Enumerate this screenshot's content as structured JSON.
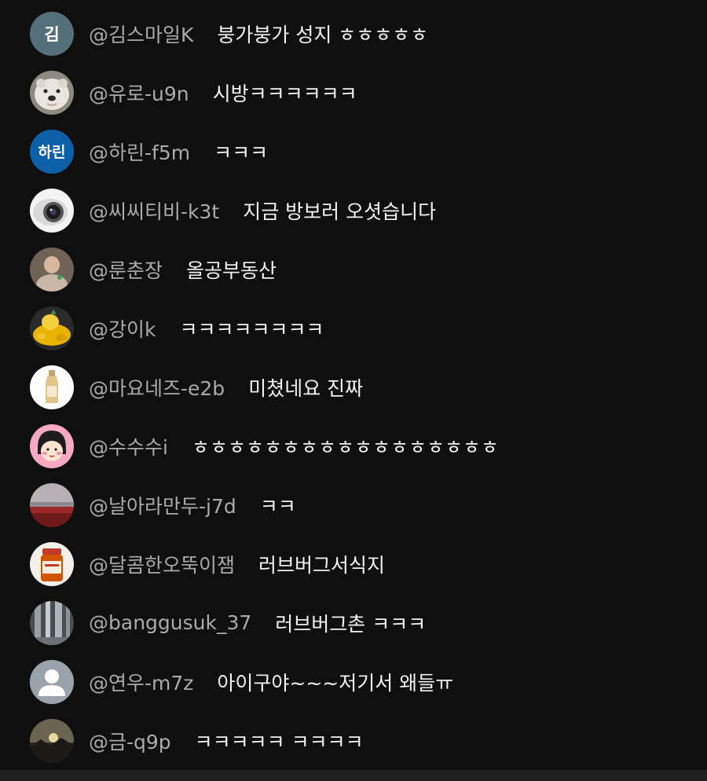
{
  "colors": {
    "background": "#0f0f0f",
    "author_text": "#aaaaaa",
    "message_text": "#f1f1f1",
    "bottom_bar": "#1f1f1f"
  },
  "messages": [
    {
      "author": "@김스마일K",
      "text": "붕가붕가 성지 ㅎㅎㅎㅎㅎ",
      "avatar": {
        "type": "initial",
        "letter": "김",
        "color": "#546e7a"
      }
    },
    {
      "author": "@유로-u9n",
      "text": "시방ㅋㅋㅋㅋㅋㅋ",
      "avatar": {
        "type": "image",
        "icon": "polar-bear-photo"
      }
    },
    {
      "author": "@하린-f5m",
      "text": "ㅋㅋㅋ",
      "avatar": {
        "type": "initial",
        "letter": "하린",
        "color": "#0d5fa8"
      }
    },
    {
      "author": "@씨씨티비-k3t",
      "text": "지금 방보러 오셧습니다",
      "avatar": {
        "type": "image",
        "icon": "cctv-camera-photo"
      }
    },
    {
      "author": "@룬춘장",
      "text": "올공부동산",
      "avatar": {
        "type": "image",
        "icon": "person-photo"
      }
    },
    {
      "author": "@강이k",
      "text": "ㅋㅋㅋㅋㅋㅋㅋㅋ",
      "avatar": {
        "type": "image",
        "icon": "yellow-fruit-photo"
      }
    },
    {
      "author": "@마요네즈-e2b",
      "text": "미쳤네요 진짜",
      "avatar": {
        "type": "image",
        "icon": "bottle-photo"
      }
    },
    {
      "author": "@수수수i",
      "text": "ㅎㅎㅎㅎㅎㅎㅎㅎㅎㅎㅎㅎㅎㅎㅎㅎㅎ",
      "avatar": {
        "type": "image",
        "icon": "cartoon-girl-avatar"
      }
    },
    {
      "author": "@날아라만두-j7d",
      "text": "ㅋㅋ",
      "avatar": {
        "type": "image",
        "icon": "sunset-field-photo"
      }
    },
    {
      "author": "@달콤한오뚝이잼",
      "text": "러브버그서식지",
      "avatar": {
        "type": "image",
        "icon": "jam-jar-photo"
      }
    },
    {
      "author": "@banggusuk_37",
      "text": "러브버그촌 ㅋㅋㅋ",
      "avatar": {
        "type": "image",
        "icon": "waterfall-photo"
      }
    },
    {
      "author": "@연우-m7z",
      "text": "아이구야~~~저기서 왜들ㅠ",
      "avatar": {
        "type": "default",
        "icon": "default-user-avatar"
      }
    },
    {
      "author": "@금-q9p",
      "text": "ㅋㅋㅋㅋㅋ ㅋㅋㅋㅋ",
      "avatar": {
        "type": "image",
        "icon": "dusk-landscape-photo"
      }
    }
  ]
}
